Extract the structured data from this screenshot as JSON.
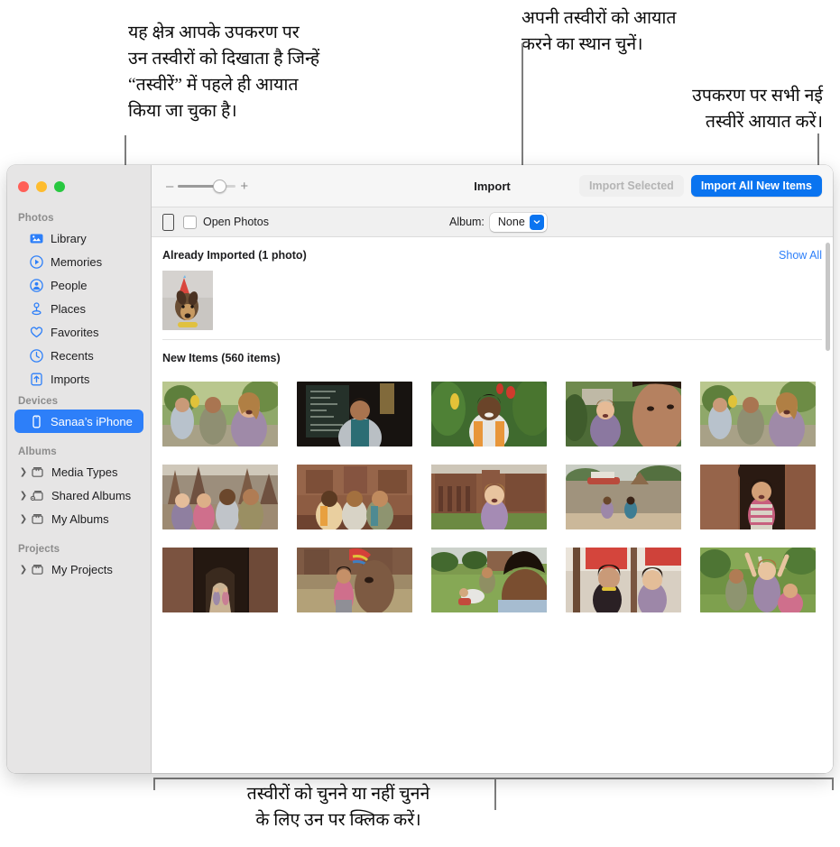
{
  "callouts": {
    "left": "यह क्षेत्र आपके उपकरण पर\nउन तस्वीरों को दिखाता है जिन्हें\n“तस्वीरें” में पहले ही आयात\nकिया जा चुका है।",
    "album": "अपनी तस्वीरों को आयात\nकरने का स्थान चुनें।",
    "import_all": "उपकरण पर सभी नई\nतस्वीरें आयात करें।",
    "bottom": "तस्वीरों को चुनने या नहीं चुनने\nके लिए उन पर क्लिक करें।"
  },
  "window": {
    "traffic_lights": [
      "close-red",
      "minimize-yellow",
      "zoom-green"
    ]
  },
  "sidebar": {
    "sections": [
      {
        "header": "Photos",
        "items": [
          {
            "label": "Library",
            "icon": "library-icon",
            "selected": false,
            "disclosure": false
          },
          {
            "label": "Memories",
            "icon": "memories-icon",
            "selected": false,
            "disclosure": false
          },
          {
            "label": "People",
            "icon": "people-icon",
            "selected": false,
            "disclosure": false
          },
          {
            "label": "Places",
            "icon": "places-icon",
            "selected": false,
            "disclosure": false
          },
          {
            "label": "Favorites",
            "icon": "heart-icon",
            "selected": false,
            "disclosure": false
          },
          {
            "label": "Recents",
            "icon": "clock-icon",
            "selected": false,
            "disclosure": false
          },
          {
            "label": "Imports",
            "icon": "import-icon",
            "selected": false,
            "disclosure": false
          }
        ]
      },
      {
        "header": "Devices",
        "items": [
          {
            "label": "Sanaa’s iPhone",
            "icon": "iphone-icon",
            "selected": true,
            "disclosure": false
          }
        ]
      },
      {
        "header": "Albums",
        "items": [
          {
            "label": "Media Types",
            "icon": "album-icon",
            "selected": false,
            "disclosure": true
          },
          {
            "label": "Shared Albums",
            "icon": "shared-album-icon",
            "selected": false,
            "disclosure": true
          },
          {
            "label": "My Albums",
            "icon": "album-icon",
            "selected": false,
            "disclosure": true
          }
        ]
      },
      {
        "header": "Projects",
        "items": [
          {
            "label": "My Projects",
            "icon": "album-icon",
            "selected": false,
            "disclosure": true
          }
        ]
      }
    ]
  },
  "toolbar": {
    "title": "Import",
    "zoom_minus": "–",
    "zoom_plus": "+",
    "import_selected": "Import Selected",
    "import_all_new": "Import All New Items"
  },
  "subbar": {
    "open_photos": "Open Photos",
    "album_label": "Album:",
    "album_value": "None",
    "album_options": [
      "None"
    ]
  },
  "content": {
    "already_imported_title": "Already Imported (1 photo)",
    "show_all": "Show All",
    "new_items_title": "New Items (560 items)",
    "already_imported": [
      {
        "alt": "dog-with-party-hat"
      }
    ],
    "new_items": [
      {
        "alt": "two-women-laughing-garden-path"
      },
      {
        "alt": "man-in-doorway-dark-interior"
      },
      {
        "alt": "man-smiling-among-plants"
      },
      {
        "alt": "woman-backpack-near-trees"
      },
      {
        "alt": "two-women-laughing-garden-path-2"
      },
      {
        "alt": "four-friends-at-temple-ruins"
      },
      {
        "alt": "three-friends-sitting-brick-temple"
      },
      {
        "alt": "woman-walking-temple-ruins"
      },
      {
        "alt": "two-people-sitting-by-river-boat"
      },
      {
        "alt": "woman-in-temple-archway"
      },
      {
        "alt": "people-walking-stone-corridor"
      },
      {
        "alt": "woman-beside-decorated-tree"
      },
      {
        "alt": "friends-relaxing-on-grass"
      },
      {
        "alt": "women-under-red-canopy"
      },
      {
        "alt": "friends-arms-raised-outdoors"
      }
    ]
  },
  "colors": {
    "accent": "#0a74f0",
    "selection": "#2d7ff9",
    "link": "#2d7ff9",
    "sidebar_bg": "#e6e5e5",
    "toolbar_bg": "#f6f6f6",
    "callout_line": "#7d7d7d"
  }
}
